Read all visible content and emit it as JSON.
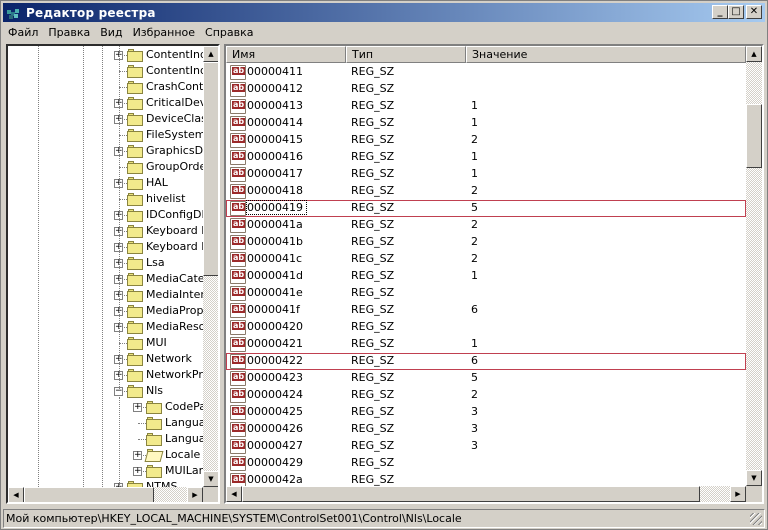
{
  "window": {
    "title": "Редактор реестра",
    "buttons": {
      "minimize": "_",
      "maximize": "□",
      "close": "✕"
    }
  },
  "menu": [
    "Файл",
    "Правка",
    "Вид",
    "Избранное",
    "Справка"
  ],
  "tree": {
    "items": [
      {
        "label": "ContentInde",
        "expander": "+",
        "level": 4
      },
      {
        "label": "ContentInde",
        "expander": "",
        "level": 4
      },
      {
        "label": "CrashContro",
        "expander": "",
        "level": 4
      },
      {
        "label": "CriticalDevic",
        "expander": "+",
        "level": 4
      },
      {
        "label": "DeviceClasse",
        "expander": "+",
        "level": 4
      },
      {
        "label": "FileSystem",
        "expander": "",
        "level": 4
      },
      {
        "label": "GraphicsDriv",
        "expander": "+",
        "level": 4
      },
      {
        "label": "GroupOrderI",
        "expander": "",
        "level": 4
      },
      {
        "label": "HAL",
        "expander": "+",
        "level": 4
      },
      {
        "label": "hivelist",
        "expander": "",
        "level": 4
      },
      {
        "label": "IDConfigDB",
        "expander": "+",
        "level": 4
      },
      {
        "label": "Keyboard La",
        "expander": "+",
        "level": 4
      },
      {
        "label": "Keyboard La",
        "expander": "+",
        "level": 4
      },
      {
        "label": "Lsa",
        "expander": "+",
        "level": 4
      },
      {
        "label": "MediaCatego",
        "expander": "+",
        "level": 4
      },
      {
        "label": "MediaInterfa",
        "expander": "+",
        "level": 4
      },
      {
        "label": "MediaProper",
        "expander": "+",
        "level": 4
      },
      {
        "label": "MediaResou",
        "expander": "+",
        "level": 4
      },
      {
        "label": "MUI",
        "expander": "",
        "level": 4
      },
      {
        "label": "Network",
        "expander": "+",
        "level": 4
      },
      {
        "label": "NetworkProv",
        "expander": "+",
        "level": 4
      },
      {
        "label": "Nls",
        "expander": "−",
        "level": 4
      },
      {
        "label": "CodePag",
        "expander": "+",
        "level": 5
      },
      {
        "label": "Languag",
        "expander": "",
        "level": 5
      },
      {
        "label": "Languag",
        "expander": "",
        "level": 5
      },
      {
        "label": "Locale",
        "expander": "+",
        "level": 5,
        "open": true
      },
      {
        "label": "MUILang",
        "expander": "+",
        "level": 5
      },
      {
        "label": "NTMS",
        "expander": "+",
        "level": 4
      }
    ]
  },
  "list": {
    "columns": [
      "Имя",
      "Тип",
      "Значение"
    ],
    "icon": "ab",
    "rows": [
      {
        "name": "00000411",
        "type": "REG_SZ",
        "value": ""
      },
      {
        "name": "00000412",
        "type": "REG_SZ",
        "value": ""
      },
      {
        "name": "00000413",
        "type": "REG_SZ",
        "value": "1"
      },
      {
        "name": "00000414",
        "type": "REG_SZ",
        "value": "1"
      },
      {
        "name": "00000415",
        "type": "REG_SZ",
        "value": "2"
      },
      {
        "name": "00000416",
        "type": "REG_SZ",
        "value": "1"
      },
      {
        "name": "00000417",
        "type": "REG_SZ",
        "value": "1"
      },
      {
        "name": "00000418",
        "type": "REG_SZ",
        "value": "2"
      },
      {
        "name": "00000419",
        "type": "REG_SZ",
        "value": "5",
        "highlighted": true,
        "focused": true
      },
      {
        "name": "0000041a",
        "type": "REG_SZ",
        "value": "2"
      },
      {
        "name": "0000041b",
        "type": "REG_SZ",
        "value": "2"
      },
      {
        "name": "0000041c",
        "type": "REG_SZ",
        "value": "2"
      },
      {
        "name": "0000041d",
        "type": "REG_SZ",
        "value": "1"
      },
      {
        "name": "0000041e",
        "type": "REG_SZ",
        "value": ""
      },
      {
        "name": "0000041f",
        "type": "REG_SZ",
        "value": "6"
      },
      {
        "name": "00000420",
        "type": "REG_SZ",
        "value": ""
      },
      {
        "name": "00000421",
        "type": "REG_SZ",
        "value": "1"
      },
      {
        "name": "00000422",
        "type": "REG_SZ",
        "value": "6",
        "highlighted": true
      },
      {
        "name": "00000423",
        "type": "REG_SZ",
        "value": "5"
      },
      {
        "name": "00000424",
        "type": "REG_SZ",
        "value": "2"
      },
      {
        "name": "00000425",
        "type": "REG_SZ",
        "value": "3"
      },
      {
        "name": "00000426",
        "type": "REG_SZ",
        "value": "3"
      },
      {
        "name": "00000427",
        "type": "REG_SZ",
        "value": "3"
      },
      {
        "name": "00000429",
        "type": "REG_SZ",
        "value": ""
      },
      {
        "name": "0000042a",
        "type": "REG_SZ",
        "value": ""
      }
    ]
  },
  "status": {
    "path": "Мой компьютер\\HKEY_LOCAL_MACHINE\\SYSTEM\\ControlSet001\\Control\\Nls\\Locale"
  },
  "colors": {
    "title_start": "#0a246a",
    "title_end": "#a6caf0",
    "highlight_box": "#c04050",
    "icon_red": "#9c2a2a"
  }
}
